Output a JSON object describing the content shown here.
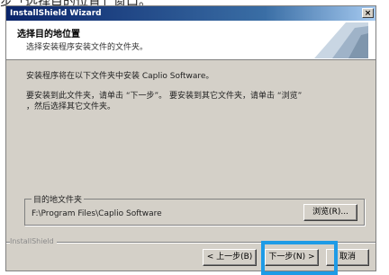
{
  "caption": "步「选择目的位置」窗口。",
  "window": {
    "title": "InstallShield Wizard",
    "close_glyph": "×"
  },
  "header": {
    "title": "选择目的地位置",
    "subtitle": "选择安装程序安装文件的文件夹。"
  },
  "body": {
    "line1": "安装程序将在以下文件夹中安装 Caplio Software。",
    "line2": "要安装到此文件夹，请单击 “下一步”。 要安装到其它文件夹，请单击 “浏览”",
    "line3": "，然后选择其它文件夹。"
  },
  "destination": {
    "group_label": "目的地文件夹",
    "path": "F:\\Program Files\\Caplio Software",
    "browse_label": "浏览(R)..."
  },
  "footer": {
    "brand": "InstallShield",
    "back_label": "< 上一步(B)",
    "next_label": "下一步(N) >",
    "cancel_label": "取消"
  },
  "colors": {
    "highlight": "#1e9be6",
    "titlebar": "#0a246a"
  },
  "icons": [
    "close-icon",
    "wizard-graphic-icon"
  ]
}
